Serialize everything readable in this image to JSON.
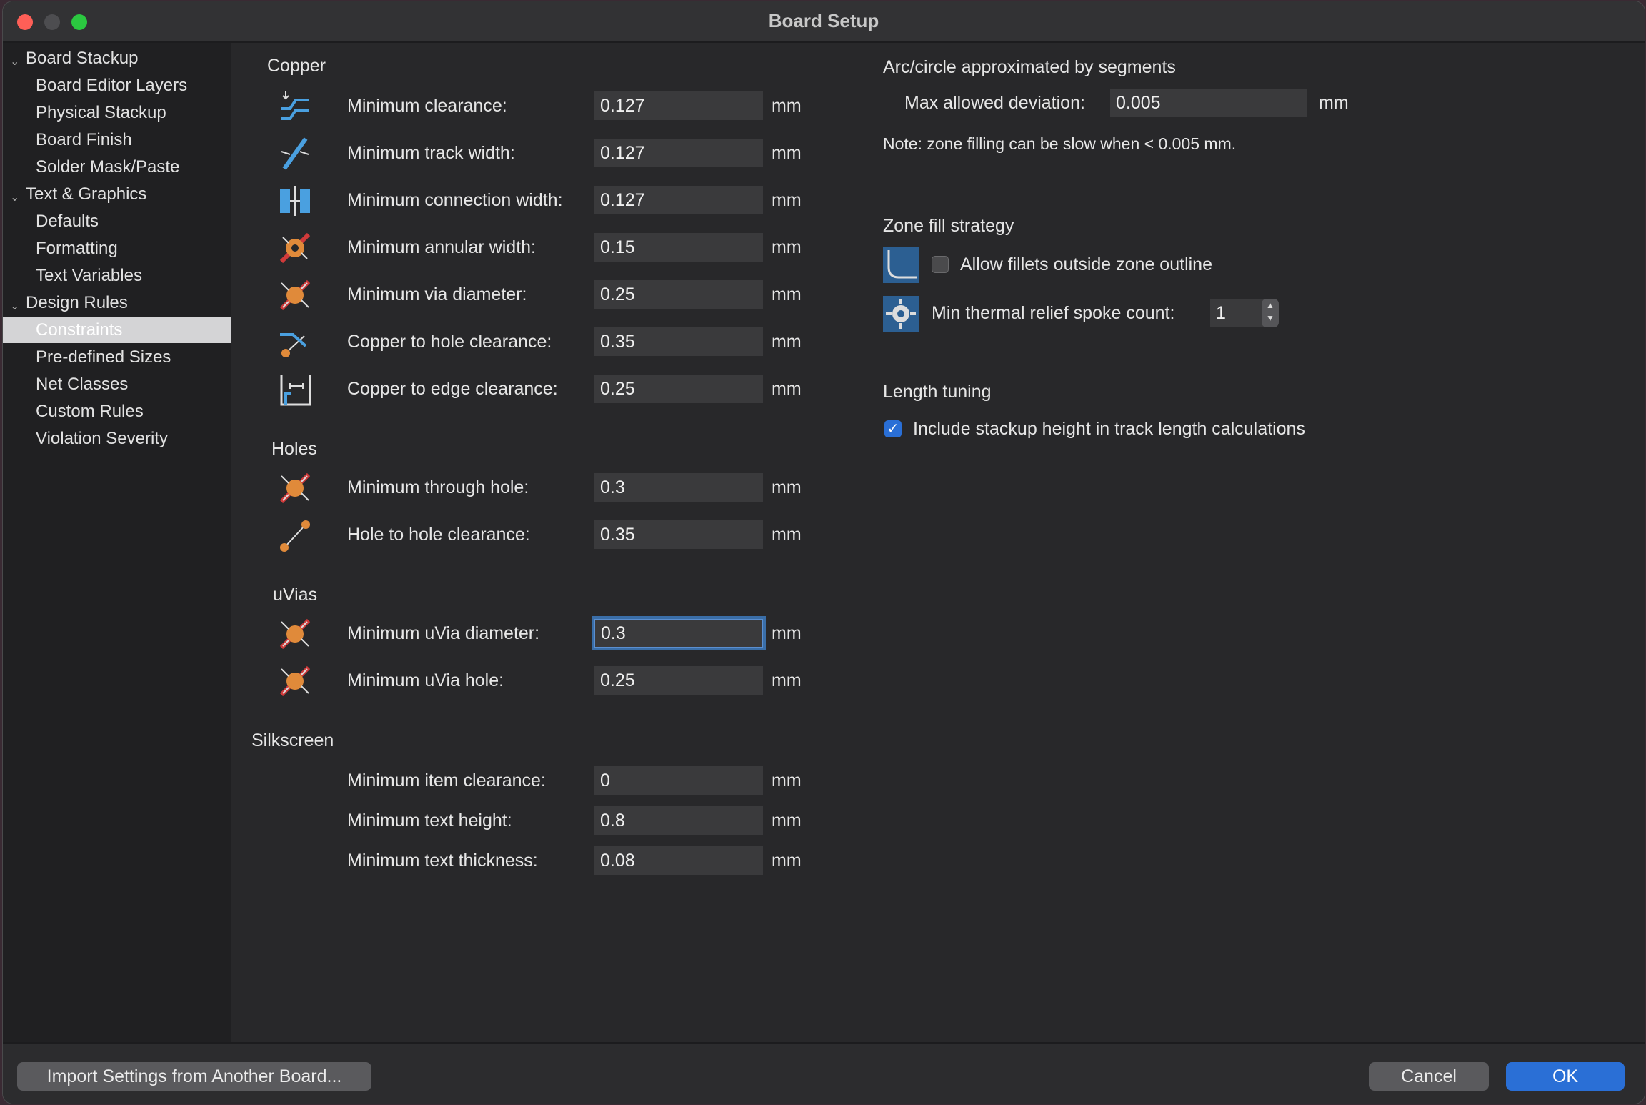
{
  "window": {
    "title": "Board Setup"
  },
  "sidebar": {
    "groups": [
      {
        "label": "Board Stackup",
        "children": [
          "Board Editor Layers",
          "Physical Stackup",
          "Board Finish",
          "Solder Mask/Paste"
        ]
      },
      {
        "label": "Text & Graphics",
        "children": [
          "Defaults",
          "Formatting",
          "Text Variables"
        ]
      },
      {
        "label": "Design Rules",
        "children": [
          "Constraints",
          "Pre-defined Sizes",
          "Net Classes",
          "Custom Rules",
          "Violation Severity"
        ]
      }
    ],
    "selected": "Constraints"
  },
  "copper": {
    "title": "Copper",
    "rows": [
      {
        "label": "Minimum clearance:",
        "value": "0.127",
        "unit": "mm"
      },
      {
        "label": "Minimum track width:",
        "value": "0.127",
        "unit": "mm"
      },
      {
        "label": "Minimum connection width:",
        "value": "0.127",
        "unit": "mm"
      },
      {
        "label": "Minimum annular width:",
        "value": "0.15",
        "unit": "mm"
      },
      {
        "label": "Minimum via diameter:",
        "value": "0.25",
        "unit": "mm"
      },
      {
        "label": "Copper to hole clearance:",
        "value": "0.35",
        "unit": "mm"
      },
      {
        "label": "Copper to edge clearance:",
        "value": "0.25",
        "unit": "mm"
      }
    ]
  },
  "holes": {
    "title": "Holes",
    "rows": [
      {
        "label": "Minimum through hole:",
        "value": "0.3",
        "unit": "mm"
      },
      {
        "label": "Hole to hole clearance:",
        "value": "0.35",
        "unit": "mm"
      }
    ]
  },
  "uvias": {
    "title": "uVias",
    "rows": [
      {
        "label": "Minimum uVia diameter:",
        "value": "0.3",
        "unit": "mm"
      },
      {
        "label": "Minimum uVia hole:",
        "value": "0.25",
        "unit": "mm"
      }
    ]
  },
  "silkscreen": {
    "title": "Silkscreen",
    "rows": [
      {
        "label": "Minimum item clearance:",
        "value": "0",
        "unit": "mm"
      },
      {
        "label": "Minimum text height:",
        "value": "0.8",
        "unit": "mm"
      },
      {
        "label": "Minimum text thickness:",
        "value": "0.08",
        "unit": "mm"
      }
    ]
  },
  "arc": {
    "title": "Arc/circle approximated by segments",
    "deviation_label": "Max allowed deviation:",
    "deviation_value": "0.005",
    "unit": "mm",
    "note": "Note: zone filling can be slow when < 0.005 mm."
  },
  "zone_fill": {
    "title": "Zone fill strategy",
    "allow_fillets_label": "Allow fillets outside zone outline",
    "allow_fillets_checked": false,
    "spoke_label": "Min thermal relief spoke count:",
    "spoke_value": "1"
  },
  "length_tuning": {
    "title": "Length tuning",
    "include_label": "Include stackup height in track length calculations",
    "include_checked": true
  },
  "footer": {
    "import_label": "Import Settings from Another Board...",
    "cancel_label": "Cancel",
    "ok_label": "OK"
  },
  "colors": {
    "accent": "#2a6fd6",
    "icon_blue": "#4aa0e0",
    "icon_orange": "#e08a3a",
    "icon_red": "#d03a3a"
  }
}
